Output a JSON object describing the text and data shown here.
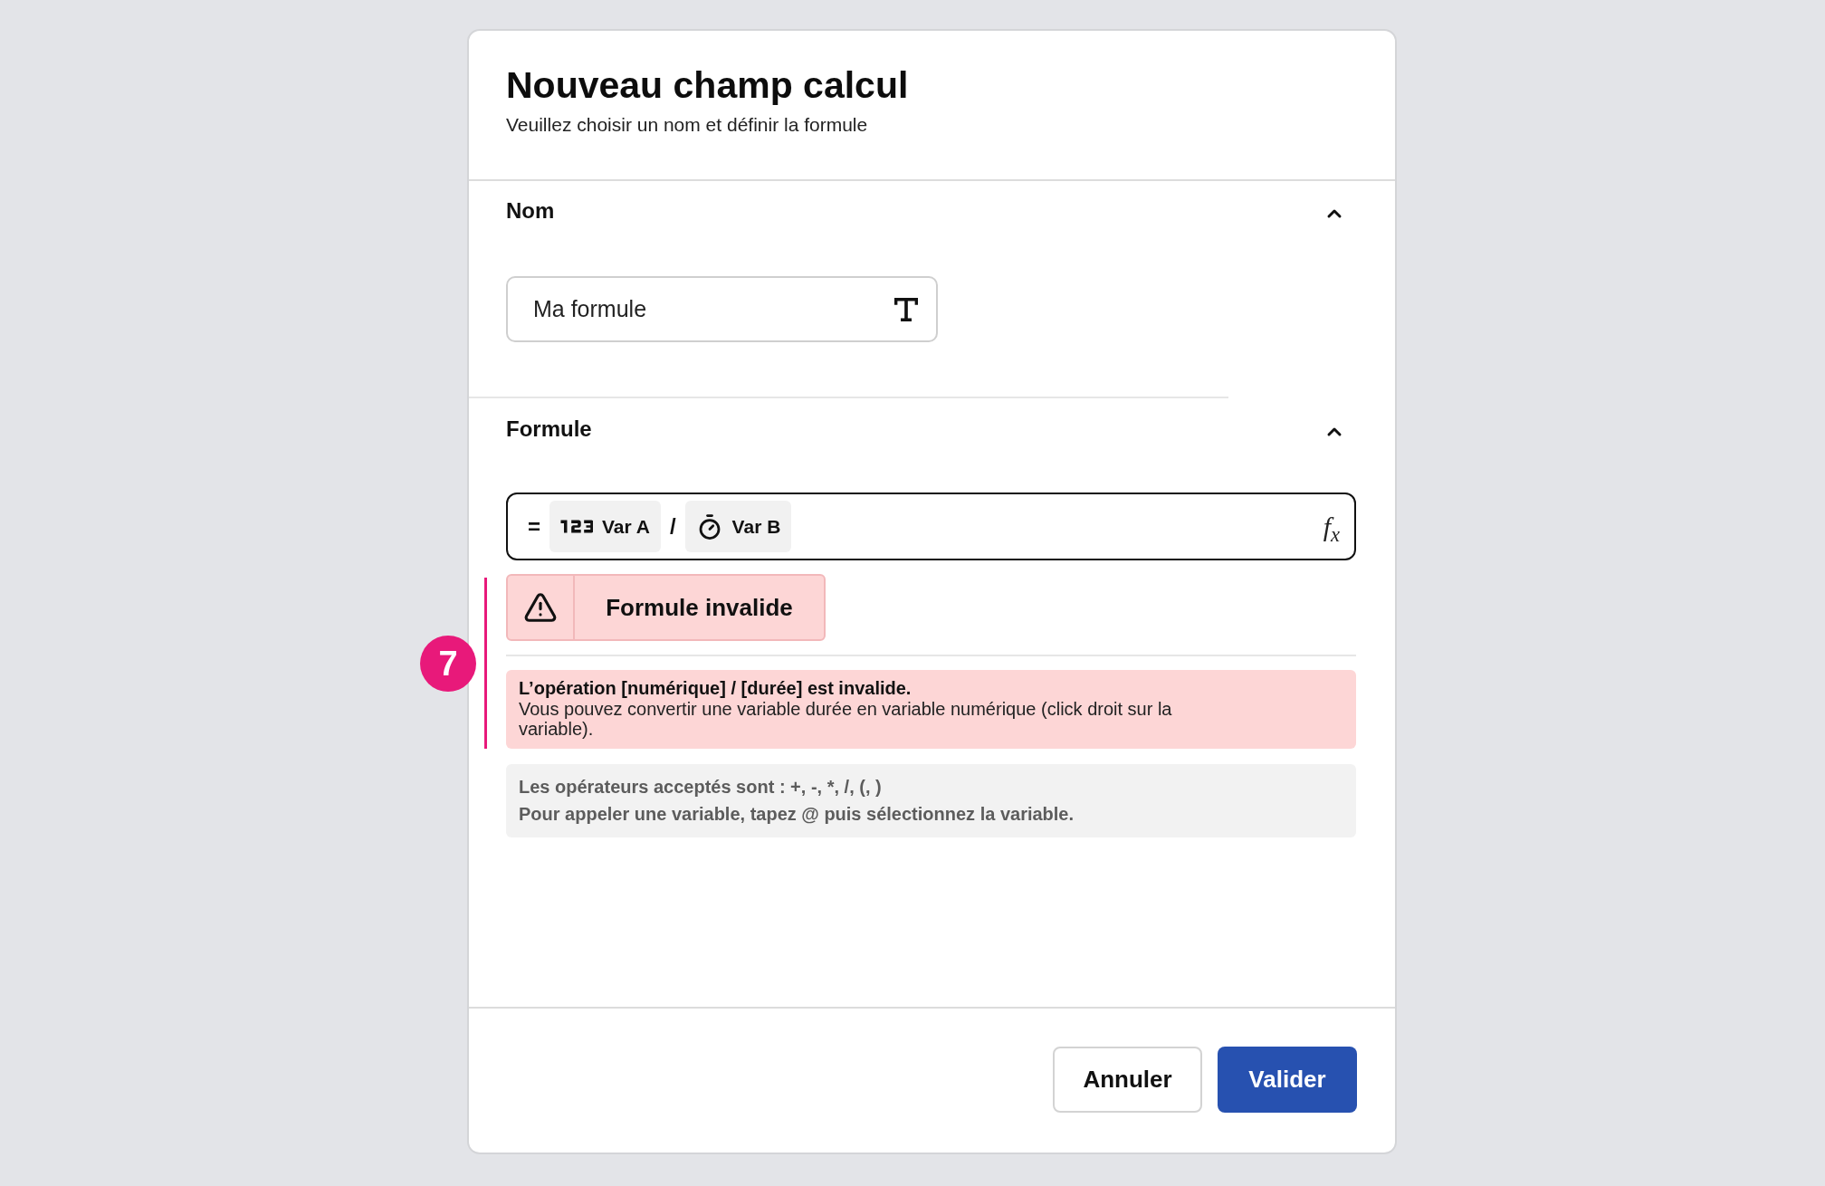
{
  "dialog": {
    "title": "Nouveau champ calcul",
    "subtitle": "Veuillez choisir un nom et définir la formule"
  },
  "sections": [
    {
      "kind": "name",
      "title": "Nom",
      "expanded": true,
      "field": {
        "value": "Ma formule"
      }
    },
    {
      "kind": "formula",
      "title": "Formule",
      "expanded": true,
      "formula": {
        "tokens": [
          {
            "kind": "operator",
            "text": "="
          },
          {
            "kind": "number",
            "label": "Var A"
          },
          {
            "kind": "operator",
            "text": "/"
          },
          {
            "kind": "duration",
            "label": "Var B"
          }
        ],
        "function_symbol": "f$_{x}$"
      },
      "status": {
        "label": "Formule invalide"
      },
      "annotation": {
        "number": "7"
      },
      "error": {
        "title": "L’opération [numérique] / [durée] est invalide.",
        "message": "Vous pouvez convertir une variable durée en variable numérique (click droit sur la variable)."
      },
      "help": [
        "Les opérateurs acceptés sont : +, -, *, /, (, )",
        "Pour appeler une variable, tapez @ puis sélectionnez la variable."
      ]
    }
  ],
  "buttons": [
    {
      "kind": "secondary",
      "label": "Annuler"
    },
    {
      "kind": "primary",
      "label": "Valider"
    }
  ]
}
